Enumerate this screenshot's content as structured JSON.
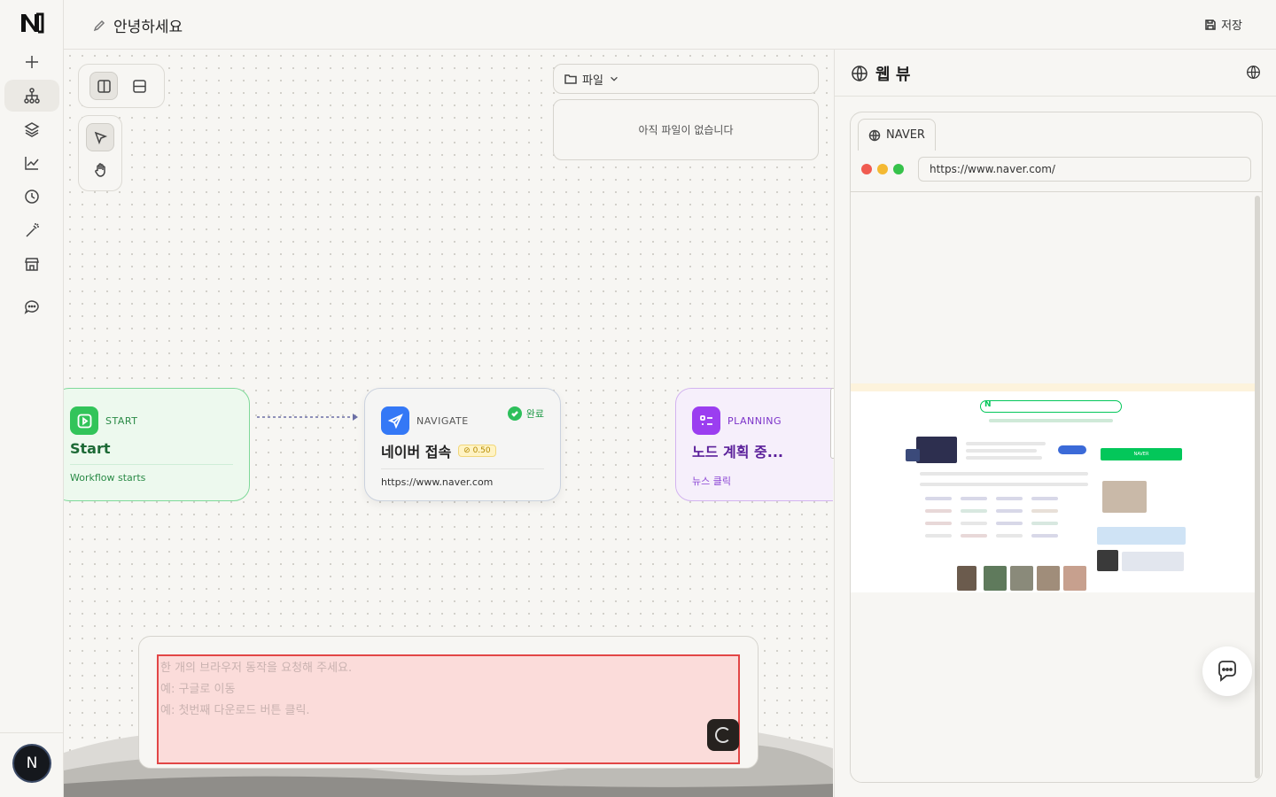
{
  "app": {
    "title": "안녕하세요",
    "save_label": "저장"
  },
  "sidebar": {
    "items": [
      {
        "icon": "plus-icon"
      },
      {
        "icon": "workflow-icon",
        "active": true
      },
      {
        "icon": "layers-icon"
      },
      {
        "icon": "chart-icon"
      },
      {
        "icon": "clock-icon"
      },
      {
        "icon": "magic-wand-icon"
      },
      {
        "icon": "store-icon"
      },
      {
        "icon": "chat-icon"
      }
    ],
    "avatar_letter": "N"
  },
  "files": {
    "dropdown_label": "파일",
    "empty_text": "아직 파일이 없습니다"
  },
  "nodes": {
    "start": {
      "type": "START",
      "name": "Start",
      "sub": "Workflow starts"
    },
    "navigate": {
      "type": "NAVIGATE",
      "name": "네이버 접속",
      "badge": "0.50",
      "status": "완료",
      "sub": "https://www.naver.com"
    },
    "planning": {
      "type": "PLANNING",
      "name": "노드 계획 중...",
      "sub": "뉴스 클릭"
    }
  },
  "prompt": {
    "placeholder": "한 개의 브라우저 동작을 요청해 주세요.\n예: 구글로 이동\n예: 첫번째 다운로드 버튼 클릭.",
    "value": ""
  },
  "webview": {
    "title": "웹 뷰",
    "tab_label": "NAVER",
    "url": "https://www.naver.com/"
  },
  "colors": {
    "accent_green": "#32c45a",
    "accent_blue": "#3478f6",
    "accent_purple": "#9b3ef0",
    "highlight_red": "#e24646",
    "naver_green": "#03c75a"
  }
}
